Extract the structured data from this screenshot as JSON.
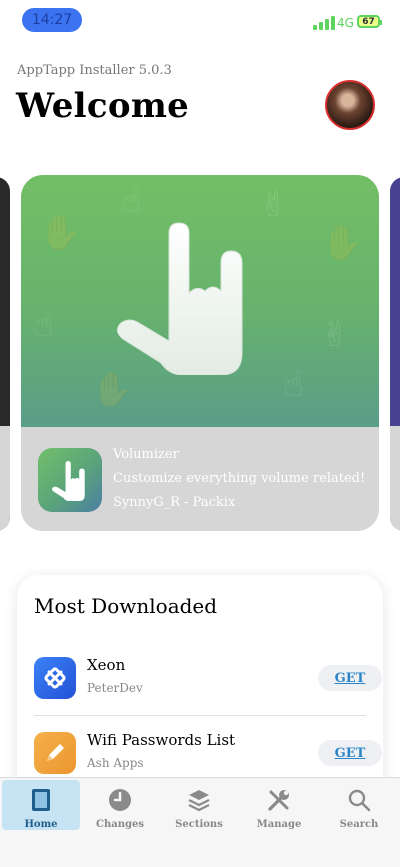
{
  "status_bar": {
    "time": "14:27",
    "network": "4G",
    "battery": "67"
  },
  "header": {
    "subtitle": "AppTapp Installer 5.0.3",
    "title": "Welcome"
  },
  "featured": {
    "name": "Volumizer",
    "description": "Customize everything volume related!",
    "developer": "SynnyG_R - Packix",
    "icon": "rock-hand-icon"
  },
  "most_downloaded": {
    "title": "Most Downloaded",
    "items": [
      {
        "name": "Xeon",
        "developer": "PeterDev",
        "button": "GET",
        "icon": "xeon-icon",
        "icon_color": "#2f6be6"
      },
      {
        "name": "Wifi Passwords List",
        "developer": "Ash Apps",
        "button": "GET",
        "icon": "pencil-icon",
        "icon_color": "#f0a43c"
      }
    ]
  },
  "tabs": [
    {
      "label": "Home",
      "icon": "home-icon",
      "active": true
    },
    {
      "label": "Changes",
      "icon": "clock-icon",
      "active": false
    },
    {
      "label": "Sections",
      "icon": "layers-icon",
      "active": false
    },
    {
      "label": "Manage",
      "icon": "tools-icon",
      "active": false
    },
    {
      "label": "Search",
      "icon": "search-icon",
      "active": false
    }
  ],
  "colors": {
    "accent": "#2b86c9",
    "tab_active_bg": "#c5e3f3",
    "banner_green": "#73bf66"
  }
}
